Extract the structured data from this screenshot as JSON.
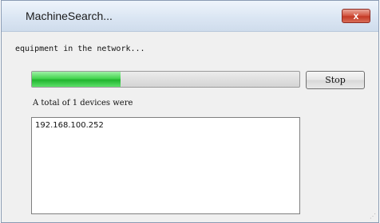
{
  "window": {
    "title": "MachineSearch...",
    "close_label": "x"
  },
  "status_text": "equipment in the network...",
  "progress": {
    "fraction": 0.33
  },
  "stop_label": "Stop",
  "total_text": "A total of 1 devices were",
  "devices": [
    "192.168.100.252"
  ]
}
